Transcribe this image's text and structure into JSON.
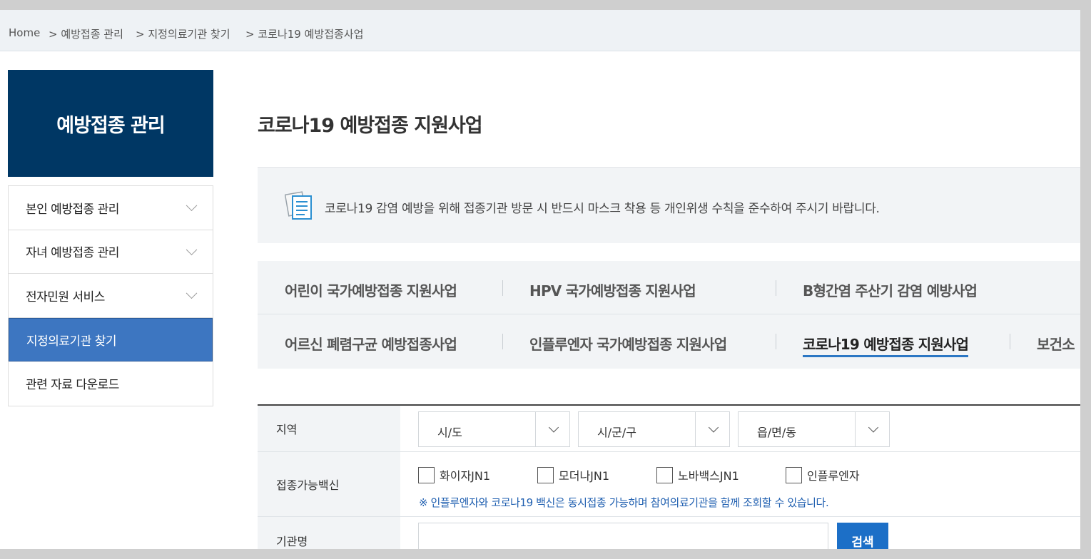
{
  "breadcrumb": {
    "home": "Home",
    "items": [
      "> 예방접종 관리",
      "> 지정의료기관 찾기",
      "> 코로나19 예방접종사업"
    ]
  },
  "sidebar": {
    "title": "예방접종 관리",
    "items": [
      {
        "label": "본인 예방접종 관리"
      },
      {
        "label": "자녀 예방접종 관리"
      },
      {
        "label": "전자민원 서비스"
      },
      {
        "label": "지정의료기관 찾기"
      },
      {
        "label": "관련 자료 다운로드"
      }
    ]
  },
  "main": {
    "title": "코로나19 예방접종 지원사업",
    "notice": "코로나19 감염 예방을 위해 접종기관 방문 시 반드시 마스크 착용 등 개인위생 수칙을 준수하여 주시기 바랍니다.",
    "tabs": [
      {
        "label": "어린이 국가예방접종 지원사업"
      },
      {
        "label": "HPV 국가예방접종 지원사업"
      },
      {
        "label": "B형간염 주산기 감염 예방사업"
      },
      {
        "label": "어르신 폐렴구균 예방접종사업"
      },
      {
        "label": "인플루엔자 국가예방접종 지원사업"
      },
      {
        "label": "코로나19 예방접종 지원사업"
      },
      {
        "label": "보건소"
      }
    ]
  },
  "form": {
    "region_label": "지역",
    "sido": "시/도",
    "sigungu": "시/군/구",
    "eupmyeondong": "읍/면/동",
    "vaccine_label": "접종가능백신",
    "vaccines": [
      "화이자JN1",
      "모더나JN1",
      "노바백스JN1",
      "인플루엔자"
    ],
    "vaccine_note": "※ 인플루엔자와 코로나19 백신은 동시접종 가능하며 참여의료기관을 함께 조회할 수 있습니다.",
    "name_label": "기관명",
    "name_value": "",
    "search_label": "검색"
  },
  "colors": {
    "sidebar_header": "#003764",
    "sidebar_active": "#3d76c1",
    "accent": "#2c77c4",
    "search_button": "#1c6fc7",
    "note_text": "#1f5fb0"
  }
}
